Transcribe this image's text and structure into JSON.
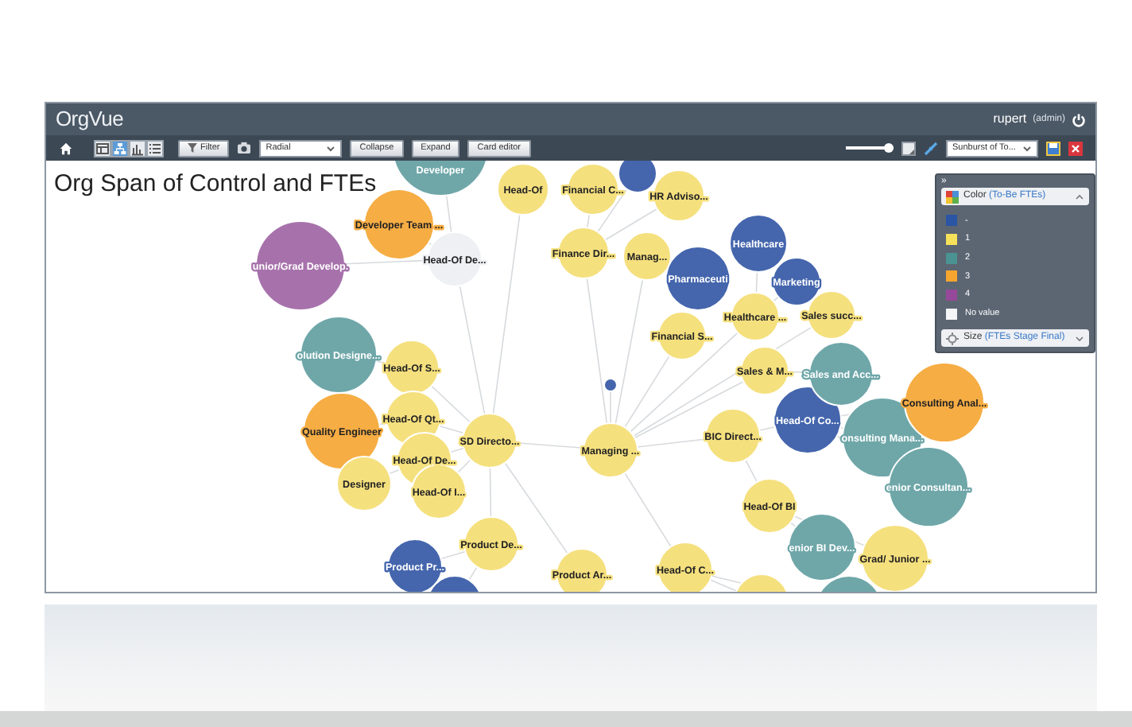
{
  "header": {
    "logo": "OrgVue",
    "user": "rupert",
    "role": "(admin)"
  },
  "toolbar": {
    "views": [
      {
        "kind": "table",
        "selected": false
      },
      {
        "kind": "tree",
        "selected": true
      },
      {
        "kind": "bars",
        "selected": false
      },
      {
        "kind": "list",
        "selected": false
      }
    ],
    "filter": "Filter",
    "layout": "Radial",
    "buttons": [
      "Collapse",
      "Expand",
      "Card editor"
    ],
    "zoom": {
      "level": 0.9
    },
    "view_select": "Sunburst of To..."
  },
  "chart_title": "Org Span of Control and FTEs",
  "graph": {
    "label": "Managing ...",
    "color": "#f5e07e",
    "children": [
      {
        "label": "SD Directo...",
        "color": "#f5e07e",
        "children": [
          {
            "label": "Head-Of De...",
            "color": "#eef0f3",
            "children": [
              {
                "label": "Developer",
                "color": "#6fa7a9"
              },
              {
                "label": "Developer Team ...",
                "color": "#f6ad44"
              },
              {
                "label": "unior/Grad Develop.",
                "color": "#a772ac"
              }
            ]
          },
          {
            "label": "Head-Of S...",
            "color": "#f5e07e",
            "children": [
              {
                "label": "olution Designe...",
                "color": "#6fa7a9"
              }
            ]
          },
          {
            "label": "Head-Of Qt...",
            "color": "#f5e07e",
            "children": [
              {
                "label": "Quality Engineer",
                "color": "#f6ad44"
              }
            ]
          },
          {
            "label": "Head-Of De...",
            "color": "#f5e07e",
            "children": [
              {
                "label": "Designer",
                "color": "#f5e07e"
              }
            ]
          },
          {
            "label": "Head-Of I...",
            "color": "#f5e07e"
          },
          {
            "label": "Product De...",
            "color": "#f5e07e",
            "children": [
              {
                "label": "Product Pr...",
                "color": "#4566ad"
              },
              {
                "color": "#4566ad"
              }
            ]
          },
          {
            "label": "Head-Of",
            "color": "#f5e07e"
          },
          {
            "label": "Product Ar...",
            "color": "#f5e07e"
          }
        ]
      },
      {
        "label": "BIC Direct...",
        "color": "#f5e07e",
        "children": [
          {
            "label": "Head-Of Co...",
            "color": "#4566ad",
            "children": [
              {
                "label": "onsulting Mana...",
                "color": "#6fa7a9"
              },
              {
                "label": "Consulting Anal...",
                "color": "#f6ad44"
              },
              {
                "label": "enior Consultan...",
                "color": "#6fa7a9"
              }
            ]
          },
          {
            "label": "Head-Of BI",
            "color": "#f5e07e",
            "children": [
              {
                "label": "enior BI Dev...",
                "color": "#6fa7a9"
              },
              {
                "label": "Grad/ Junior ...",
                "color": "#f5e07e"
              }
            ]
          }
        ]
      },
      {
        "label": "Finance Dir...",
        "color": "#f5e07e",
        "children": [
          {
            "color": "#4566ad"
          },
          {
            "label": "Financial C...",
            "color": "#f5e07e"
          },
          {
            "label": "HR Adviso...",
            "color": "#f5e07e"
          }
        ]
      },
      {
        "label": "Manag...",
        "color": "#f5e07e",
        "children": [
          {
            "label": "Pharmaceuti",
            "color": "#4566ad"
          }
        ]
      },
      {
        "label": "Financial S...",
        "color": "#f5e07e"
      },
      {
        "label": "Healthcare ...",
        "color": "#f5e07e",
        "children": [
          {
            "label": "Healthcare",
            "color": "#4566ad"
          },
          {
            "label": "Marketing",
            "color": "#4566ad"
          }
        ]
      },
      {
        "label": "Sales succ...",
        "color": "#f5e07e"
      },
      {
        "label": "Sales & M...",
        "color": "#f5e07e",
        "children": [
          {
            "label": "Sales and Acc...",
            "color": "#6fa7a9"
          }
        ]
      },
      {
        "color": "#4566ad"
      },
      {
        "label": "Head-Of C...",
        "color": "#f5e07e",
        "children": [
          {
            "color": "#f5e07e"
          },
          {
            "color": "#6fa7a9"
          }
        ]
      }
    ]
  },
  "legend": {
    "collapse": "»",
    "color_section": {
      "title": "Color",
      "field": "(To-Be FTEs)",
      "expanded": true
    },
    "items": [
      {
        "label": "-",
        "color": "#2a55a5"
      },
      {
        "label": "1",
        "color": "#f6e15a"
      },
      {
        "label": "2",
        "color": "#4a9392"
      },
      {
        "label": "3",
        "color": "#f6a52e"
      },
      {
        "label": "4",
        "color": "#96499a"
      },
      {
        "label": "No value",
        "color": "#f4f5f7"
      }
    ],
    "size_section": {
      "title": "Size",
      "field": "(FTEs Stage Final)",
      "expanded": false
    }
  }
}
